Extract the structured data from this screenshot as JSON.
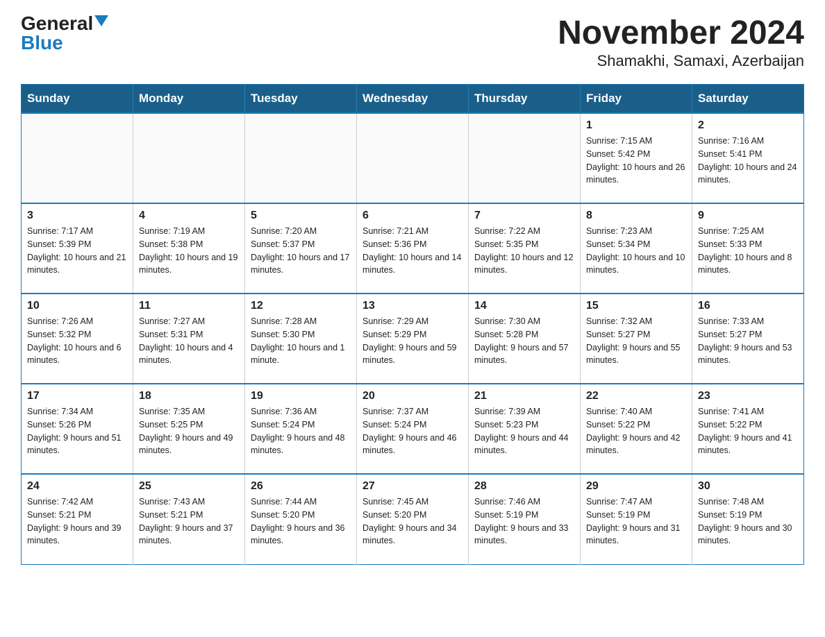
{
  "logo": {
    "general": "General",
    "blue": "Blue"
  },
  "title": "November 2024",
  "subtitle": "Shamakhi, Samaxi, Azerbaijan",
  "weekdays": [
    "Sunday",
    "Monday",
    "Tuesday",
    "Wednesday",
    "Thursday",
    "Friday",
    "Saturday"
  ],
  "weeks": [
    [
      {
        "day": "",
        "info": ""
      },
      {
        "day": "",
        "info": ""
      },
      {
        "day": "",
        "info": ""
      },
      {
        "day": "",
        "info": ""
      },
      {
        "day": "",
        "info": ""
      },
      {
        "day": "1",
        "info": "Sunrise: 7:15 AM\nSunset: 5:42 PM\nDaylight: 10 hours and 26 minutes."
      },
      {
        "day": "2",
        "info": "Sunrise: 7:16 AM\nSunset: 5:41 PM\nDaylight: 10 hours and 24 minutes."
      }
    ],
    [
      {
        "day": "3",
        "info": "Sunrise: 7:17 AM\nSunset: 5:39 PM\nDaylight: 10 hours and 21 minutes."
      },
      {
        "day": "4",
        "info": "Sunrise: 7:19 AM\nSunset: 5:38 PM\nDaylight: 10 hours and 19 minutes."
      },
      {
        "day": "5",
        "info": "Sunrise: 7:20 AM\nSunset: 5:37 PM\nDaylight: 10 hours and 17 minutes."
      },
      {
        "day": "6",
        "info": "Sunrise: 7:21 AM\nSunset: 5:36 PM\nDaylight: 10 hours and 14 minutes."
      },
      {
        "day": "7",
        "info": "Sunrise: 7:22 AM\nSunset: 5:35 PM\nDaylight: 10 hours and 12 minutes."
      },
      {
        "day": "8",
        "info": "Sunrise: 7:23 AM\nSunset: 5:34 PM\nDaylight: 10 hours and 10 minutes."
      },
      {
        "day": "9",
        "info": "Sunrise: 7:25 AM\nSunset: 5:33 PM\nDaylight: 10 hours and 8 minutes."
      }
    ],
    [
      {
        "day": "10",
        "info": "Sunrise: 7:26 AM\nSunset: 5:32 PM\nDaylight: 10 hours and 6 minutes."
      },
      {
        "day": "11",
        "info": "Sunrise: 7:27 AM\nSunset: 5:31 PM\nDaylight: 10 hours and 4 minutes."
      },
      {
        "day": "12",
        "info": "Sunrise: 7:28 AM\nSunset: 5:30 PM\nDaylight: 10 hours and 1 minute."
      },
      {
        "day": "13",
        "info": "Sunrise: 7:29 AM\nSunset: 5:29 PM\nDaylight: 9 hours and 59 minutes."
      },
      {
        "day": "14",
        "info": "Sunrise: 7:30 AM\nSunset: 5:28 PM\nDaylight: 9 hours and 57 minutes."
      },
      {
        "day": "15",
        "info": "Sunrise: 7:32 AM\nSunset: 5:27 PM\nDaylight: 9 hours and 55 minutes."
      },
      {
        "day": "16",
        "info": "Sunrise: 7:33 AM\nSunset: 5:27 PM\nDaylight: 9 hours and 53 minutes."
      }
    ],
    [
      {
        "day": "17",
        "info": "Sunrise: 7:34 AM\nSunset: 5:26 PM\nDaylight: 9 hours and 51 minutes."
      },
      {
        "day": "18",
        "info": "Sunrise: 7:35 AM\nSunset: 5:25 PM\nDaylight: 9 hours and 49 minutes."
      },
      {
        "day": "19",
        "info": "Sunrise: 7:36 AM\nSunset: 5:24 PM\nDaylight: 9 hours and 48 minutes."
      },
      {
        "day": "20",
        "info": "Sunrise: 7:37 AM\nSunset: 5:24 PM\nDaylight: 9 hours and 46 minutes."
      },
      {
        "day": "21",
        "info": "Sunrise: 7:39 AM\nSunset: 5:23 PM\nDaylight: 9 hours and 44 minutes."
      },
      {
        "day": "22",
        "info": "Sunrise: 7:40 AM\nSunset: 5:22 PM\nDaylight: 9 hours and 42 minutes."
      },
      {
        "day": "23",
        "info": "Sunrise: 7:41 AM\nSunset: 5:22 PM\nDaylight: 9 hours and 41 minutes."
      }
    ],
    [
      {
        "day": "24",
        "info": "Sunrise: 7:42 AM\nSunset: 5:21 PM\nDaylight: 9 hours and 39 minutes."
      },
      {
        "day": "25",
        "info": "Sunrise: 7:43 AM\nSunset: 5:21 PM\nDaylight: 9 hours and 37 minutes."
      },
      {
        "day": "26",
        "info": "Sunrise: 7:44 AM\nSunset: 5:20 PM\nDaylight: 9 hours and 36 minutes."
      },
      {
        "day": "27",
        "info": "Sunrise: 7:45 AM\nSunset: 5:20 PM\nDaylight: 9 hours and 34 minutes."
      },
      {
        "day": "28",
        "info": "Sunrise: 7:46 AM\nSunset: 5:19 PM\nDaylight: 9 hours and 33 minutes."
      },
      {
        "day": "29",
        "info": "Sunrise: 7:47 AM\nSunset: 5:19 PM\nDaylight: 9 hours and 31 minutes."
      },
      {
        "day": "30",
        "info": "Sunrise: 7:48 AM\nSunset: 5:19 PM\nDaylight: 9 hours and 30 minutes."
      }
    ]
  ]
}
